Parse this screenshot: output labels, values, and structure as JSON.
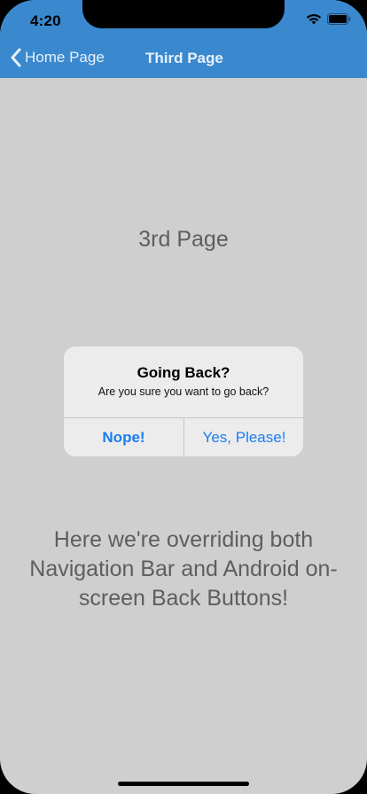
{
  "status_bar": {
    "time": "4:20",
    "icons": [
      "wifi-icon",
      "battery-icon"
    ]
  },
  "nav_bar": {
    "back_label": "Home Page",
    "back_icon": "chevron-left-icon",
    "title": "Third Page",
    "background_color": "#3a89cf"
  },
  "page": {
    "heading": "3rd Page",
    "description": "Here we're overriding both Navigation Bar and Android on-screen Back Buttons!"
  },
  "alert": {
    "title": "Going Back?",
    "message": "Are you sure you want to go back?",
    "cancel_label": "Nope!",
    "confirm_label": "Yes, Please!",
    "button_color": "#1a7ef1"
  }
}
